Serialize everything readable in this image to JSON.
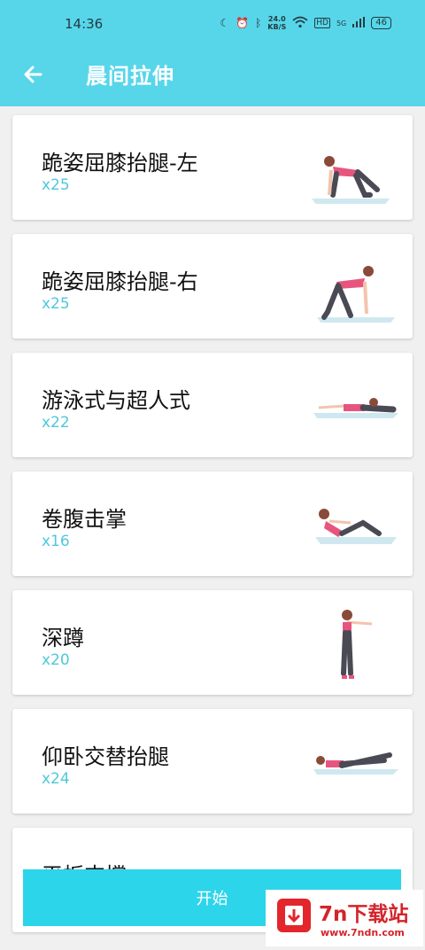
{
  "status": {
    "time": "14:36",
    "speed_value": "24.0",
    "speed_unit": "KB/S",
    "network": "5G",
    "battery": "46"
  },
  "appbar": {
    "title": "晨间拉伸"
  },
  "exercises": [
    {
      "name": "跪姿屈膝抬腿-左",
      "reps": "x25"
    },
    {
      "name": "跪姿屈膝抬腿-右",
      "reps": "x25"
    },
    {
      "name": "游泳式与超人式",
      "reps": "x22"
    },
    {
      "name": "卷腹击掌",
      "reps": "x16"
    },
    {
      "name": "深蹲",
      "reps": "x20"
    },
    {
      "name": "仰卧交替抬腿",
      "reps": "x24"
    },
    {
      "name": "平板支撑",
      "reps": ""
    }
  ],
  "footer": {
    "start_label": "开始"
  },
  "watermark": {
    "brand": "7n下载站",
    "url": "www.7ndn.com"
  },
  "colors": {
    "accent": "#57d6ea",
    "button": "#2dd5ea",
    "reps_text": "#4fc8dc",
    "watermark": "#d3242a"
  }
}
